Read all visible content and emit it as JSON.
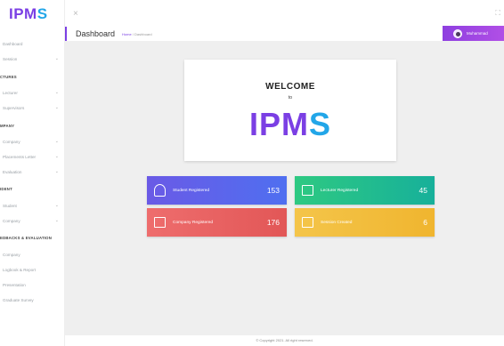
{
  "app": {
    "logo_main": "IPM",
    "logo_accent": "S"
  },
  "sidebar": {
    "items": [
      {
        "label": "Dashboard",
        "chevron": false
      },
      {
        "label": "Session",
        "chevron": true
      },
      {
        "header": "CTURES"
      },
      {
        "label": "Lecturer",
        "chevron": true
      },
      {
        "label": "Supervisors",
        "chevron": true
      },
      {
        "header": "MPANY"
      },
      {
        "label": "Company",
        "chevron": true
      },
      {
        "label": "Placements Letter",
        "chevron": true
      },
      {
        "label": "Evaluation",
        "chevron": true
      },
      {
        "header": "IDENT"
      },
      {
        "label": "Student",
        "chevron": true
      },
      {
        "label": "Company",
        "chevron": true
      },
      {
        "header": "EDBACKS & EVALUATION"
      },
      {
        "label": "Company",
        "chevron": false
      },
      {
        "label": "Logbook & Report",
        "chevron": false
      },
      {
        "label": "Presentation",
        "chevron": false
      },
      {
        "label": "Graduate Survey",
        "chevron": false
      }
    ]
  },
  "header": {
    "close_glyph": "×",
    "page_title": "Dashboard",
    "breadcrumb_home": "Home",
    "breadcrumb_sep": " / ",
    "breadcrumb_current": "Dashboard",
    "user_name": "Muhammad",
    "expand_glyph": "⛶"
  },
  "welcome": {
    "line1": "WELCOME",
    "line2": "to",
    "logo_main": "IPM",
    "logo_accent": "S"
  },
  "cards": [
    {
      "label": "Student Registered",
      "value": "153",
      "icon": "user-icon"
    },
    {
      "label": "Lecturer Registered",
      "value": "45",
      "icon": "briefcase-icon"
    },
    {
      "label": "Company Registered",
      "value": "176",
      "icon": "briefcase-icon"
    },
    {
      "label": "Session Created",
      "value": "6",
      "icon": "briefcase-icon"
    }
  ],
  "footer": {
    "text": "© Copyright 2021. All right reserved."
  }
}
